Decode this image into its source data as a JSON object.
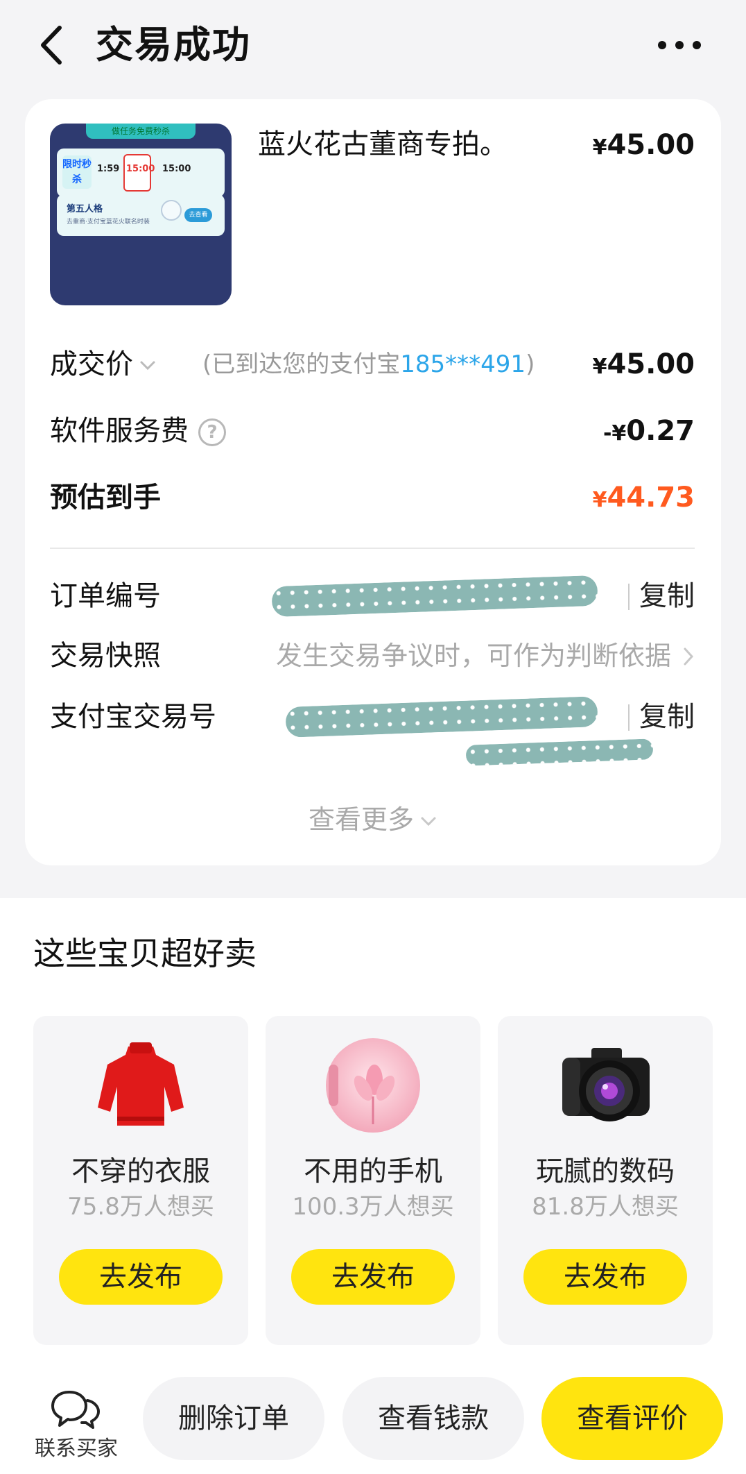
{
  "header": {
    "title": "交易成功"
  },
  "order": {
    "product_title": "蓝火花古董商专拍。",
    "product_price": "45.00",
    "currency": "¥",
    "thumbnail": {
      "banner": "做任务免费秒杀",
      "label_left": "限时秒杀",
      "times": [
        "1:59",
        "15:00",
        "15:00"
      ],
      "card_title": "第五人格",
      "card_sub": "去重商·支付宝蓝花火联名时装",
      "card_button": "去查看"
    },
    "deal": {
      "label": "成交价",
      "note_prefix": "(已到达您的支付宝",
      "account": "185***491",
      "note_suffix": ")",
      "value": "45.00"
    },
    "fee": {
      "label": "软件服务费",
      "help_symbol": "?",
      "value_prefix": "-¥",
      "value": "0.27"
    },
    "estimate": {
      "label": "预估到手",
      "value": "44.73",
      "color": "#ff5a1f"
    },
    "order_id": {
      "label": "订单编号",
      "copy": "复制"
    },
    "snapshot": {
      "label": "交易快照",
      "hint": "发生交易争议时，可作为判断依据"
    },
    "alipay_no": {
      "label": "支付宝交易号",
      "copy": "复制"
    },
    "see_more": "查看更多"
  },
  "recommend": {
    "title": "这些宝贝超好卖",
    "items": [
      {
        "name": "不穿的衣服",
        "want": "75.8万人想买",
        "button": "去发布",
        "icon": "red-sweater-image"
      },
      {
        "name": "不用的手机",
        "want": "100.3万人想买",
        "button": "去发布",
        "icon": "pink-phone-image"
      },
      {
        "name": "玩腻的数码",
        "want": "81.8万人想买",
        "button": "去发布",
        "icon": "camera-image"
      }
    ]
  },
  "bottom": {
    "contact": "联系买家",
    "delete": "删除订单",
    "view_money": "查看钱款",
    "view_review": "查看评价",
    "accent": "#ffe40f"
  }
}
